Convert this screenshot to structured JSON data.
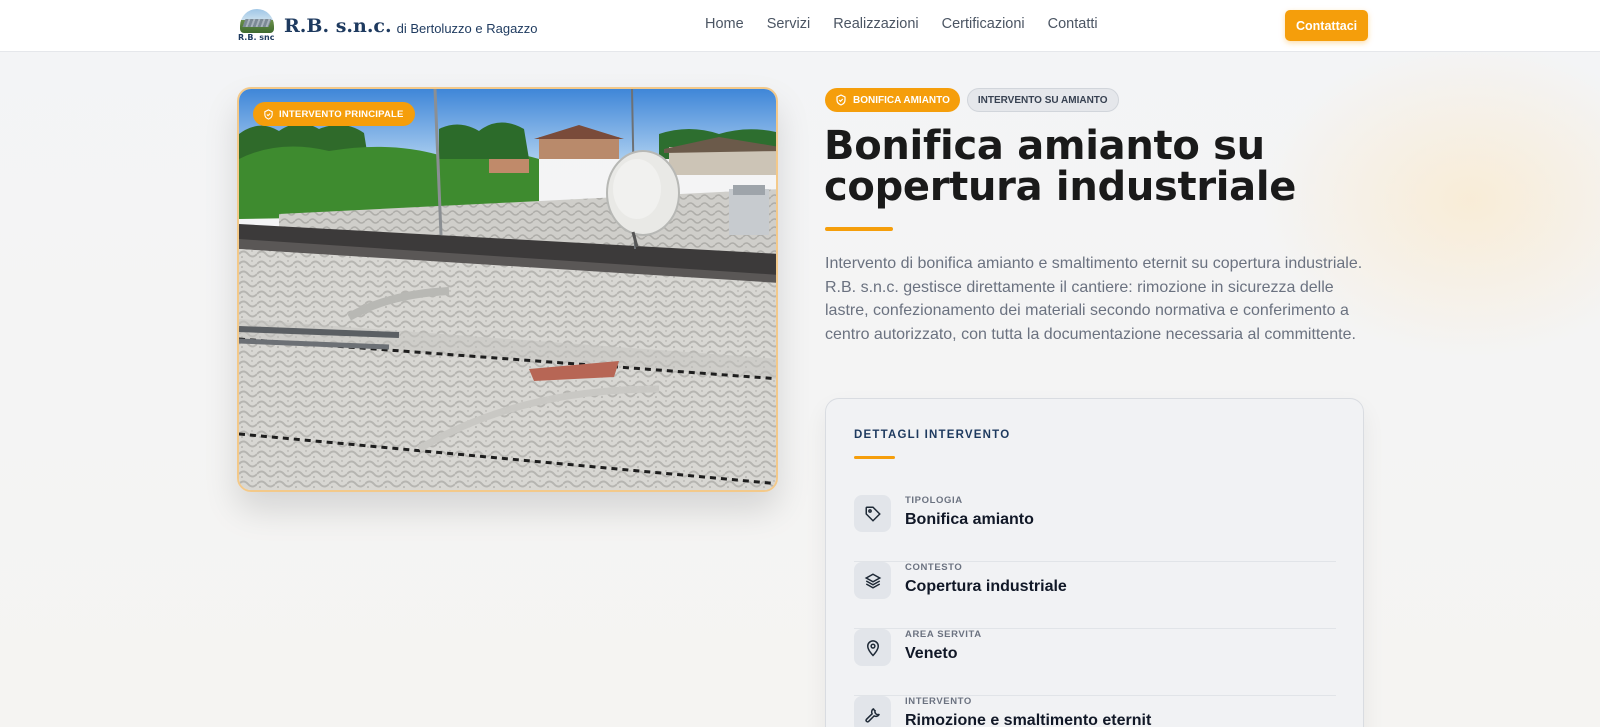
{
  "header": {
    "logo_sub": "R.B. snc",
    "logo_name": "R.B. s.n.c.",
    "logo_tagline": "di Bertoluzzo e Ragazzo",
    "nav": [
      {
        "label": "Home"
      },
      {
        "label": "Servizi"
      },
      {
        "label": "Realizzazioni"
      },
      {
        "label": "Certificazioni"
      },
      {
        "label": "Contatti"
      }
    ],
    "cta_label": "Contattaci"
  },
  "hero_image": {
    "badge": "INTERVENTO PRINCIPALE",
    "badge_icon": "shield-check-icon"
  },
  "content": {
    "badges": [
      {
        "label": "BONIFICA AMIANTO",
        "icon": "shield-check-icon"
      },
      {
        "label": "INTERVENTO SU AMIANTO"
      }
    ],
    "title": "Bonifica amianto su copertura industriale",
    "description": "Intervento di bonifica amianto e smaltimento eternit su copertura industriale. R.B. s.n.c. gestisce direttamente il cantiere: rimozione in sicurezza delle lastre, confezionamento dei materiali secondo normativa e conferimento a centro autorizzato, con tutta la documentazione necessaria al committente."
  },
  "details": {
    "title": "DETTAGLI INTERVENTO",
    "rows": [
      {
        "label": "TIPOLOGIA",
        "value": "Bonifica amianto",
        "icon": "tag-icon"
      },
      {
        "label": "CONTESTO",
        "value": "Copertura industriale",
        "icon": "layers-icon"
      },
      {
        "label": "AREA SERVITA",
        "value": "Veneto",
        "icon": "map-pin-icon"
      },
      {
        "label": "INTERVENTO",
        "value": "Rimozione e smaltimento eternit",
        "icon": "wrench-icon"
      }
    ]
  },
  "colors": {
    "accent": "#f59e0b",
    "brand": "#1e3a5f",
    "text": "#1a1a1a",
    "muted": "#6b7280"
  }
}
